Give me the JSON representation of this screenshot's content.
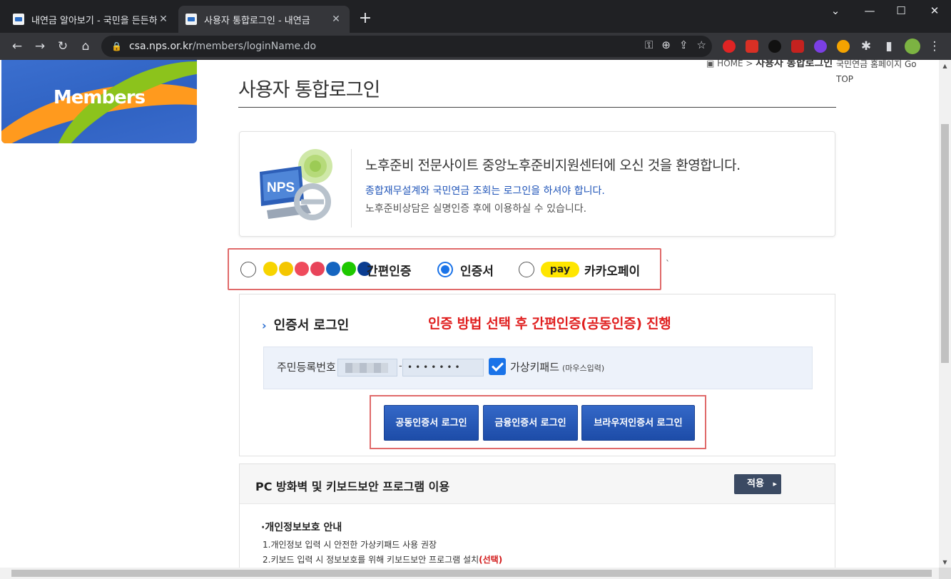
{
  "browser": {
    "tabs": [
      {
        "title": "내연금 알아보기 - 국민을 든든하"
      },
      {
        "title": "사용자 통합로그인 - 내연금"
      }
    ],
    "new_tab": "+",
    "url_host": "csa.nps.or.kr",
    "url_path": "/members/loginName.do",
    "window_controls": {
      "min": "—",
      "max": "☐",
      "close": "✕",
      "dropdown": "⌄"
    }
  },
  "page": {
    "banner_text": "Members",
    "breadcrumb_home": "HOME",
    "breadcrumb_sep": ">",
    "breadcrumb_current": "사용자 통합로그인",
    "gotop_text": "국민연금 홈페이지 Go TOP",
    "title": "사용자 통합로그인",
    "welcome": {
      "logo_text": "NPS",
      "heading": "노후준비 전문사이트 중앙노후준비지원센터에 오신 것을 환영합니다.",
      "line_blue": "종합재무설계와 국민연금 조회는 로그인을 하셔야 합니다.",
      "line_gray": "노후준비상담은 실명인증 후에 이용하실 수 있습니다."
    },
    "methods": {
      "simple_label": "간편인증",
      "cert_label": "인증서",
      "kakaopay_badge": "pay",
      "kakaopay_label": "카카오페이",
      "selected": "인증서"
    },
    "tick_mark": "`",
    "cert": {
      "title": "인증서 로그인",
      "note": "인증 방법 선택 후 간편인증(공동인증) 진행",
      "ssn_label": "주민등록번호",
      "ssn_dash": "-",
      "ssn_masked": "•••••••",
      "vk_label": "가상키패드",
      "vk_hint": "(마우스입력)",
      "buttons": [
        "공동인증서 로그인",
        "금융인증서 로그인",
        "브라우저인증서 로그인"
      ]
    },
    "security": {
      "title": "PC 방화벽 및 키보드보안 프로그램 이용",
      "apply": "적용",
      "privacy_title": "·개인정보보호 안내",
      "line1": "1.개인정보 입력 시 안전한 가상키패드 사용 권장",
      "line2": "2.키보드 입력 시 정보보호를 위해 키보드보안 프로그램 설치",
      "line2_red": "(선택)"
    }
  },
  "colors": {
    "accent_blue": "#1f54b8",
    "note_red": "#e01f1f",
    "highlight_box": "#e06a6a",
    "button_blue": "#2a5cbb",
    "kakao_yellow": "#ffe600"
  }
}
